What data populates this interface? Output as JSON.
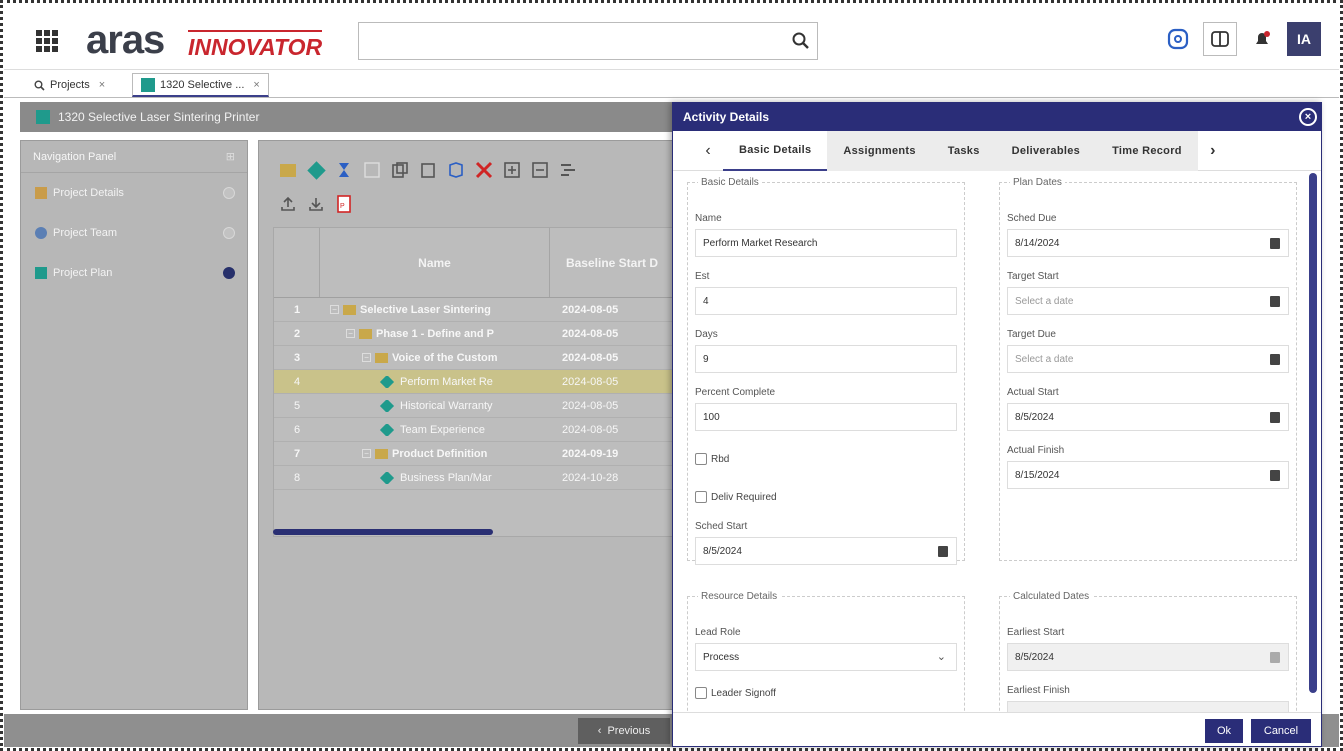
{
  "brand": {
    "logo_main": "aras",
    "logo_sub": "INNOVATOR",
    "accent": "#2a2d78",
    "logo_red": "#c9262e"
  },
  "header": {
    "search_placeholder": "",
    "avatar_initials": "IA"
  },
  "tabs": [
    {
      "label": "Projects",
      "close": "×"
    },
    {
      "label": "1320 Selective ...",
      "close": "×"
    }
  ],
  "window": {
    "title": "1320 Selective Laser Sintering Printer"
  },
  "nav": {
    "title": "Navigation Panel",
    "items": [
      {
        "label": "Project Details"
      },
      {
        "label": "Project Team"
      },
      {
        "label": "Project Plan"
      }
    ]
  },
  "grid": {
    "columns": [
      "Name",
      "Baseline Start D"
    ],
    "rows": [
      {
        "idx": "1",
        "name": "Selective Laser Sintering",
        "start": "2024-08-05",
        "bold": true,
        "type": "folder",
        "indent": 0
      },
      {
        "idx": "2",
        "name": "Phase 1 - Define and P",
        "start": "2024-08-05",
        "bold": true,
        "type": "folder",
        "indent": 1
      },
      {
        "idx": "3",
        "name": "Voice of the Custom",
        "start": "2024-08-05",
        "bold": true,
        "type": "folder",
        "indent": 2
      },
      {
        "idx": "4",
        "name": "Perform Market Re",
        "start": "2024-08-05",
        "bold": false,
        "type": "task",
        "indent": 3,
        "selected": true
      },
      {
        "idx": "5",
        "name": "Historical Warranty",
        "start": "2024-08-05",
        "bold": false,
        "type": "task",
        "indent": 3
      },
      {
        "idx": "6",
        "name": "Team Experience",
        "start": "2024-08-05",
        "bold": false,
        "type": "task",
        "indent": 3
      },
      {
        "idx": "7",
        "name": "Product Definition",
        "start": "2024-09-19",
        "bold": true,
        "type": "folder",
        "indent": 2
      },
      {
        "idx": "8",
        "name": "Business Plan/Mar",
        "start": "2024-10-28",
        "bold": false,
        "type": "task",
        "indent": 3
      }
    ]
  },
  "pager": {
    "previous": "Previous"
  },
  "dialog": {
    "title": "Activity Details",
    "tabs": [
      "Basic Details",
      "Assignments",
      "Tasks",
      "Deliverables",
      "Time Record"
    ],
    "basic": {
      "legend": "Basic Details",
      "name_label": "Name",
      "name_value": "Perform Market Research",
      "est_label": "Est",
      "est_value": "4",
      "days_label": "Days",
      "days_value": "9",
      "pc_label": "Percent Complete",
      "pc_value": "100",
      "rbd_label": "Rbd",
      "deliv_label": "Deliv Required",
      "sched_start_label": "Sched Start",
      "sched_start_value": "8/5/2024"
    },
    "plan": {
      "legend": "Plan Dates",
      "sched_due_label": "Sched Due",
      "sched_due_value": "8/14/2024",
      "target_start_label": "Target Start",
      "target_start_placeholder": "Select a date",
      "target_due_label": "Target Due",
      "target_due_placeholder": "Select a date",
      "actual_start_label": "Actual Start",
      "actual_start_value": "8/5/2024",
      "actual_finish_label": "Actual Finish",
      "actual_finish_value": "8/15/2024"
    },
    "resource": {
      "legend": "Resource Details",
      "lead_role_label": "Lead Role",
      "lead_role_value": "Process",
      "leader_signoff_label": "Leader Signoff"
    },
    "calc": {
      "legend": "Calculated Dates",
      "earliest_start_label": "Earliest Start",
      "earliest_start_value": "8/5/2024",
      "earliest_finish_label": "Earliest Finish"
    },
    "ok": "Ok",
    "cancel": "Cancel"
  }
}
